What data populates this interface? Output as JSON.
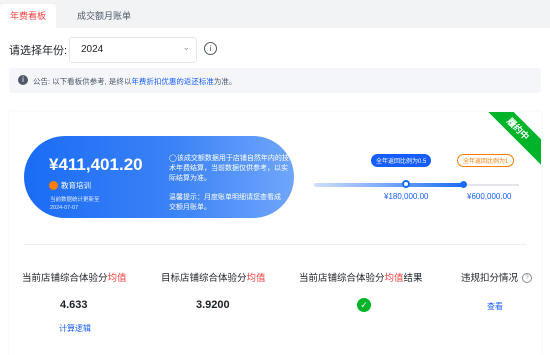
{
  "tabs": [
    {
      "label": "年费看板"
    },
    {
      "label": "成交额月账单"
    }
  ],
  "year": {
    "label": "请选择年份:",
    "value": "2024",
    "info_icon": "info-circle-icon"
  },
  "notice": {
    "prefix": "公告: 以下看板供参考, 是终以",
    "link": "年费折扣优惠的返还标准",
    "suffix": "为准。"
  },
  "card": {
    "ribbon": "履约中",
    "amount": "¥411,401.20",
    "category": "教育培训",
    "update_line1": "当前数据统计更新至",
    "update_line2": "2024-07-07",
    "note": "◯该成交额数据用于店铺自然年内的技术年费结算，当前数据仅供参考，以实际结算为准。",
    "note2": "温馨提示：月度账单明细请您查看成交额月账单。",
    "tier1_label": "全年返回比例为0.5",
    "tier2_label": "全年返回比例为1",
    "tier1_amount": "¥180,000.00",
    "tier2_amount": "¥600,000.00"
  },
  "metrics": {
    "current_score_label_a": "当前店铺综合体验分",
    "current_score_label_b": "均值",
    "current_score_value": "4.633",
    "current_score_link": "计算逻辑",
    "target_score_label_a": "目标店铺综合体验分",
    "target_score_label_b": "均值",
    "target_score_value": "3.9200",
    "result_label_a": "当前店铺综合体验分",
    "result_label_b": "均值",
    "result_label_c": "结果",
    "violation_label": "违规扣分情况",
    "violation_link": "查看"
  }
}
